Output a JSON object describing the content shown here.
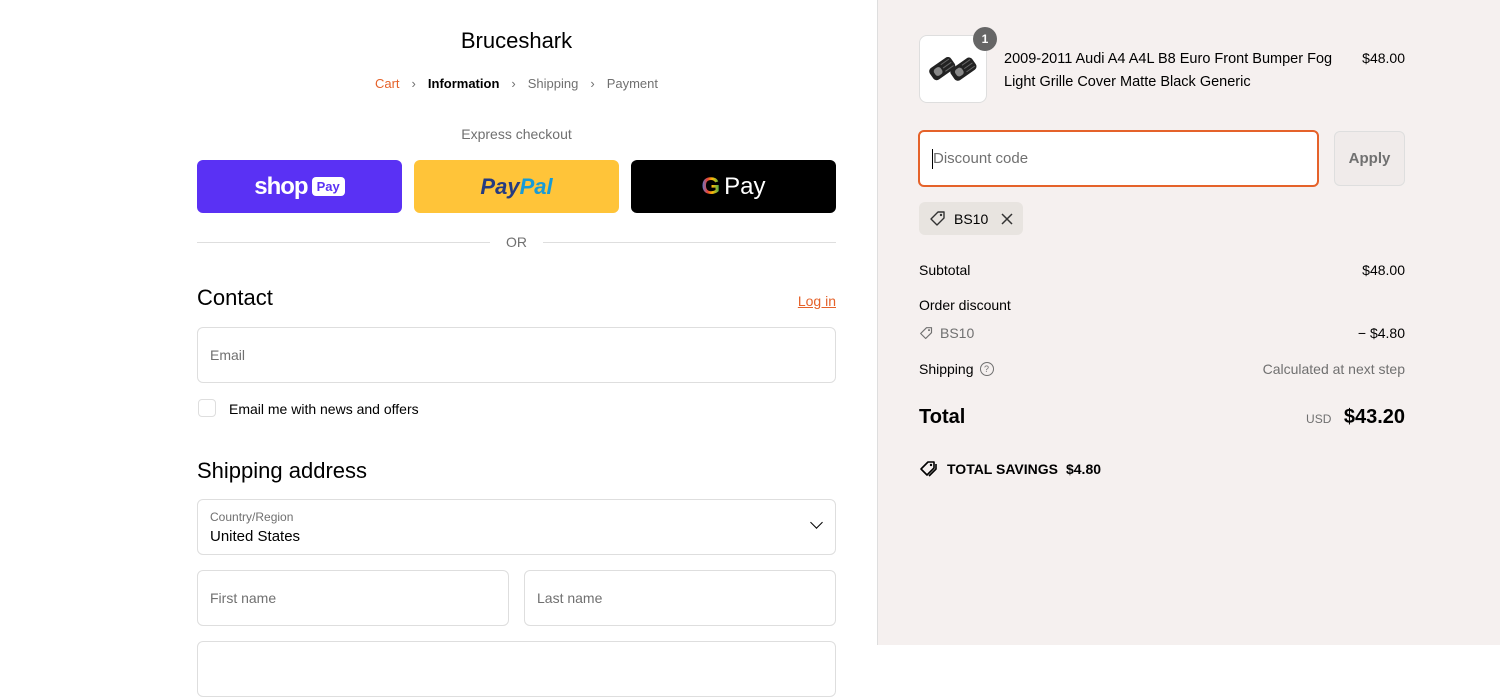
{
  "store": {
    "name": "Bruceshark"
  },
  "breadcrumb": {
    "cart": "Cart",
    "information": "Information",
    "shipping": "Shipping",
    "payment": "Payment",
    "separator": "›"
  },
  "express": {
    "label": "Express checkout",
    "shop_word": "shop",
    "shop_pill": "Pay",
    "paypal_a": "Pay",
    "paypal_b": "Pal",
    "gpay_g": "G",
    "gpay_word": "Pay"
  },
  "divider": {
    "label": "OR"
  },
  "contact": {
    "title": "Contact",
    "login": "Log in",
    "email_placeholder": "Email",
    "newsletter_label": "Email me with news and offers"
  },
  "shipping_address": {
    "title": "Shipping address",
    "country_label": "Country/Region",
    "country_value": "United States",
    "first_name_placeholder": "First name",
    "last_name_placeholder": "Last name"
  },
  "order": {
    "product_name": "2009-2011 Audi A4 A4L B8 Euro Front Bumper Fog Light Grille Cover Matte Black Generic",
    "product_price": "$48.00",
    "quantity": "1",
    "discount_placeholder": "Discount code",
    "apply_label": "Apply",
    "applied_code": "BS10",
    "subtotal_label": "Subtotal",
    "subtotal_value": "$48.00",
    "order_discount_label": "Order discount",
    "discount_code_line": "BS10",
    "discount_amount": "− $4.80",
    "shipping_label": "Shipping",
    "shipping_value": "Calculated at next step",
    "total_label": "Total",
    "currency": "USD",
    "total_value": "$43.20",
    "savings_label": "TOTAL SAVINGS",
    "savings_value": "$4.80"
  },
  "colors": {
    "accent": "#e5622a",
    "shop_pay": "#5a31f4",
    "paypal": "#ffc439",
    "gpay": "#000000",
    "sidebar_bg": "#f5f0ef"
  },
  "icons": [
    "chevron-right-icon",
    "chevron-down-icon",
    "tag-icon",
    "close-icon",
    "help-icon",
    "savings-tag-icon"
  ]
}
